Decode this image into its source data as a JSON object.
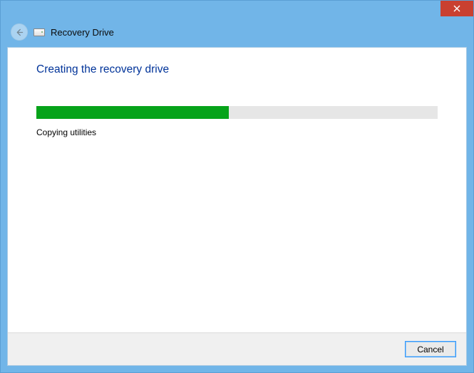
{
  "window_title": "Recovery Drive",
  "heading": "Creating the recovery drive",
  "progress_percent": 48,
  "status": "Copying utilities",
  "footer": {
    "cancel_label": "Cancel"
  },
  "colors": {
    "frame": "#71b5e8",
    "close": "#c94030",
    "heading": "#003399",
    "progress_fill": "#06a31a",
    "progress_bg": "#e6e6e6"
  }
}
